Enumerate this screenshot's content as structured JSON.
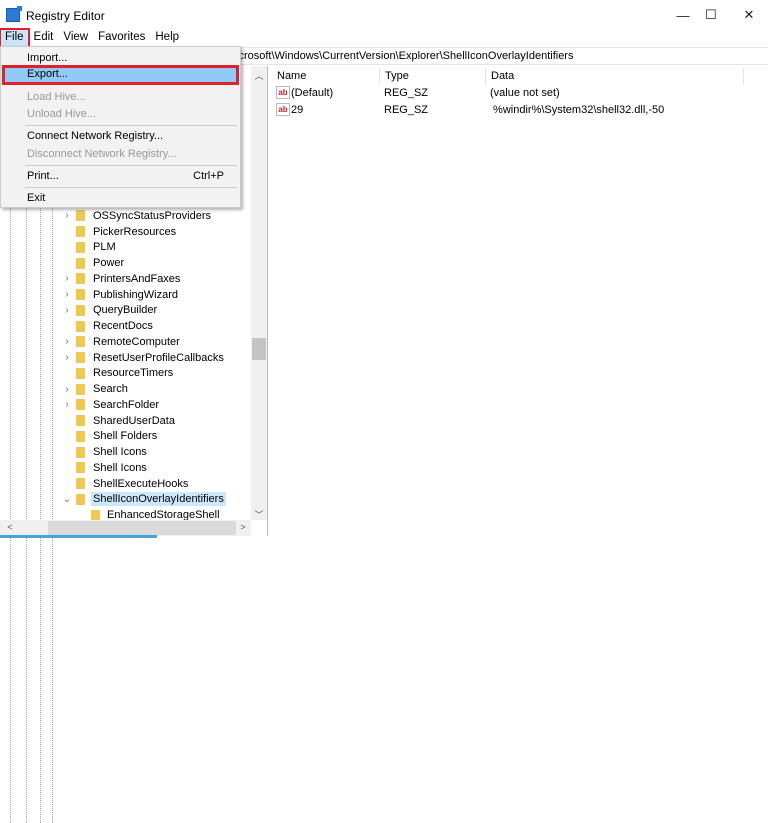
{
  "window": {
    "title": "Registry Editor",
    "minimize": "—",
    "maximize": "☐",
    "close": "✕"
  },
  "menubar": [
    "File",
    "Edit",
    "View",
    "Favorites",
    "Help"
  ],
  "address": "icrosoft\\Windows\\CurrentVersion\\Explorer\\ShellIconOverlayIdentifiers",
  "file_menu": {
    "import": "Import...",
    "export": "Export...",
    "load_hive": "Load Hive...",
    "unload_hive": "Unload Hive...",
    "connect": "Connect Network Registry...",
    "disconnect": "Disconnect Network Registry...",
    "print": "Print...",
    "print_shortcut": "Ctrl+P",
    "exit": "Exit"
  },
  "tree": [
    {
      "label": "OSSyncStatusProviders",
      "expander": true
    },
    {
      "label": "PickerResources",
      "expander": false
    },
    {
      "label": "PLM",
      "expander": false
    },
    {
      "label": "Power",
      "expander": false
    },
    {
      "label": "PrintersAndFaxes",
      "expander": true
    },
    {
      "label": "PublishingWizard",
      "expander": true
    },
    {
      "label": "QueryBuilder",
      "expander": true
    },
    {
      "label": "RecentDocs",
      "expander": false
    },
    {
      "label": "RemoteComputer",
      "expander": true
    },
    {
      "label": "ResetUserProfileCallbacks",
      "expander": true
    },
    {
      "label": "ResourceTimers",
      "expander": false
    },
    {
      "label": "Search",
      "expander": true
    },
    {
      "label": "SearchFolder",
      "expander": true
    },
    {
      "label": "SharedUserData",
      "expander": false
    },
    {
      "label": "Shell Folders",
      "expander": false
    },
    {
      "label": "Shell Icons",
      "expander": false
    },
    {
      "label": "Shell Icons",
      "expander": false
    },
    {
      "label": "ShellExecuteHooks",
      "expander": false
    },
    {
      "label": "ShellIconOverlayIdentifiers",
      "expander": true,
      "expanded": true,
      "selected": true
    },
    {
      "label": "EnhancedStorageShell",
      "expander": false,
      "child": true
    }
  ],
  "columns": {
    "name": "Name",
    "type": "Type",
    "data": "Data"
  },
  "values": [
    {
      "icon": "ab",
      "name": "(Default)",
      "type": "REG_SZ",
      "data": "(value not set)"
    },
    {
      "icon": "ab",
      "name": "29",
      "type": "REG_SZ",
      "data": " %windir%\\System32\\shell32.dll,-50"
    }
  ]
}
